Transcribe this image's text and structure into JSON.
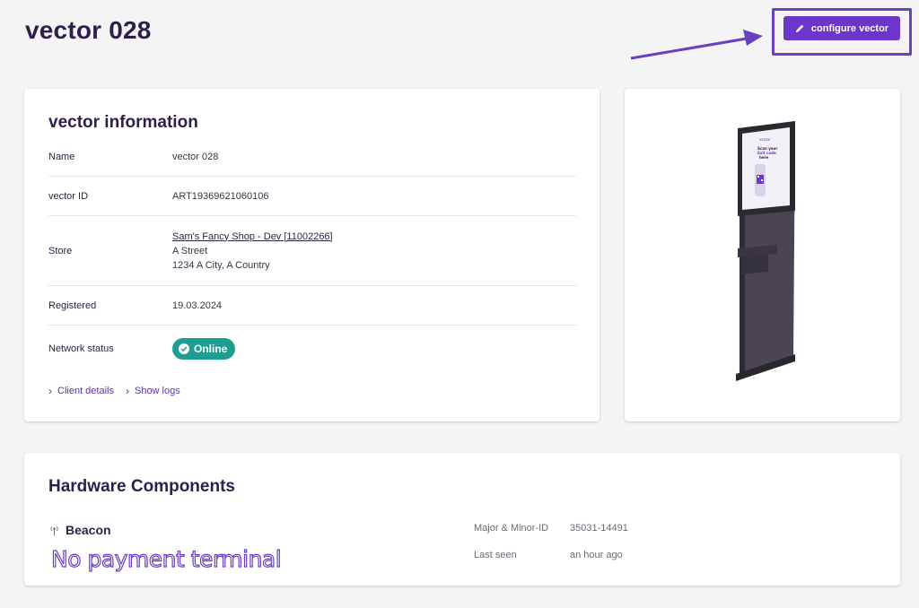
{
  "page": {
    "title": "vector 028",
    "configure_label": "configure vector"
  },
  "info": {
    "title": "vector information",
    "rows": {
      "name": {
        "label": "Name",
        "value": "vector 028"
      },
      "id": {
        "label": "vector ID",
        "value": "ART19369621060106"
      },
      "store": {
        "label": "Store",
        "link": "Sam's Fancy Shop - Dev [11002266]",
        "street": "A Street",
        "city": "1234 A City, A Country"
      },
      "registered": {
        "label": "Registered",
        "value": "19.03.2024"
      },
      "network": {
        "label": "Network status",
        "status": "Online"
      }
    },
    "links": {
      "client_details": "Client details",
      "show_logs": "Show logs"
    }
  },
  "kiosk_screen": {
    "brand": "vector",
    "line1": "Scan your",
    "line2": "Exit code",
    "line3": "here"
  },
  "hardware": {
    "title": "Hardware Components",
    "beacon_label": "Beacon",
    "annotation": "No payment terminal",
    "meta": {
      "major_minor_label": "Major & Minor-ID",
      "major_minor_value": "35031-14491",
      "last_seen_label": "Last seen",
      "last_seen_value": "an hour ago"
    }
  },
  "colors": {
    "accent": "#6b36c9",
    "status_online": "#1c9e93",
    "annotation": "#6a3fc0"
  }
}
